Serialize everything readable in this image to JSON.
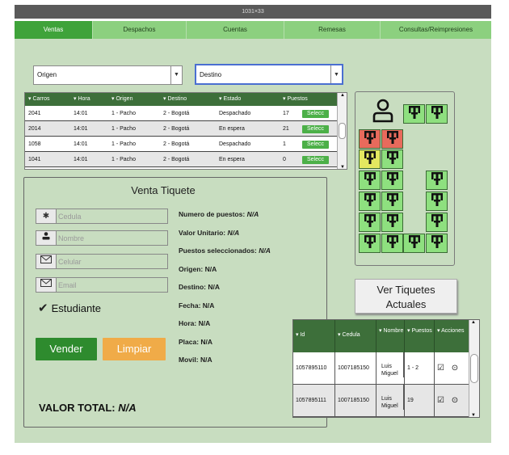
{
  "window": {
    "title": "1031×33"
  },
  "tabs": [
    {
      "label": "Ventas"
    },
    {
      "label": "Despachos"
    },
    {
      "label": "Cuentas"
    },
    {
      "label": "Remesas"
    },
    {
      "label": "Consultas/Reimpresiones"
    }
  ],
  "filters": {
    "origen": "Origen",
    "destino": "Destino"
  },
  "bus_table": {
    "headers": [
      "▾ Carros",
      "▾ Hora",
      "▾ Origen",
      "▾ Destino",
      "▾ Estado",
      "▾ Puestos"
    ],
    "select_label": "Selecc",
    "rows": [
      {
        "carro": "2041",
        "hora": "14:01",
        "origen": "1 - Pacho",
        "destino": "2 - Bogotá",
        "estado": "Despachado",
        "puestos": "17"
      },
      {
        "carro": "2014",
        "hora": "14:01",
        "origen": "1 - Pacho",
        "destino": "2 - Bogotá",
        "estado": "En espera",
        "puestos": "21"
      },
      {
        "carro": "1058",
        "hora": "14:01",
        "origen": "1 - Pacho",
        "destino": "2 - Bogotá",
        "estado": "Despachado",
        "puestos": "1"
      },
      {
        "carro": "1041",
        "hora": "14:01",
        "origen": "1 - Pacho",
        "destino": "2 - Bogotá",
        "estado": "En espera",
        "puestos": "0"
      }
    ]
  },
  "venta": {
    "title": "Venta Tiquete",
    "placeholders": {
      "cedula": "Cedula",
      "nombre": "Nombre",
      "celular": "Celular",
      "email": "Email"
    },
    "student_label": "Estudiante",
    "vender": "Vender",
    "limpiar": "Limpiar",
    "info": [
      {
        "label": "Numero de puestos:",
        "value": "N/A"
      },
      {
        "label": "Valor Unitario:",
        "value": "N/A"
      },
      {
        "label": "Puestos seleccionados:",
        "value": "N/A"
      },
      {
        "label": "Origen:",
        "value": "N/A"
      },
      {
        "label": "Destino:",
        "value": "N/A"
      },
      {
        "label": "Fecha:",
        "value": "N/A"
      },
      {
        "label": "Hora:",
        "value": "N/A"
      },
      {
        "label": "Placa:",
        "value": "N/A"
      },
      {
        "label": "Movil:",
        "value": "N/A"
      }
    ],
    "total_label": "VALOR TOTAL:",
    "total_value": "N/A"
  },
  "colors": {
    "seat_free": "#8ee07f",
    "seat_taken": "#e86a5c",
    "seat_reserved": "#e4e860",
    "accent": "#3fa33a"
  },
  "ver_tiquetes": {
    "line1": "Ver Tiquetes",
    "line2": "Actuales"
  },
  "tiquetes_table": {
    "headers": [
      "▾ Id",
      "▾ Cedula",
      "▾ Nombre",
      "▾ Puestos",
      "▾ Acciones"
    ],
    "rows": [
      {
        "id": "1057895110",
        "cedula": "1007185150",
        "nombre1": "Luis",
        "nombre2": "Miguel",
        "puestos": "1 - 2"
      },
      {
        "id": "1057895111",
        "cedula": "1007185150",
        "nombre1": "Luis",
        "nombre2": "Miguel",
        "puestos": "19"
      }
    ]
  }
}
